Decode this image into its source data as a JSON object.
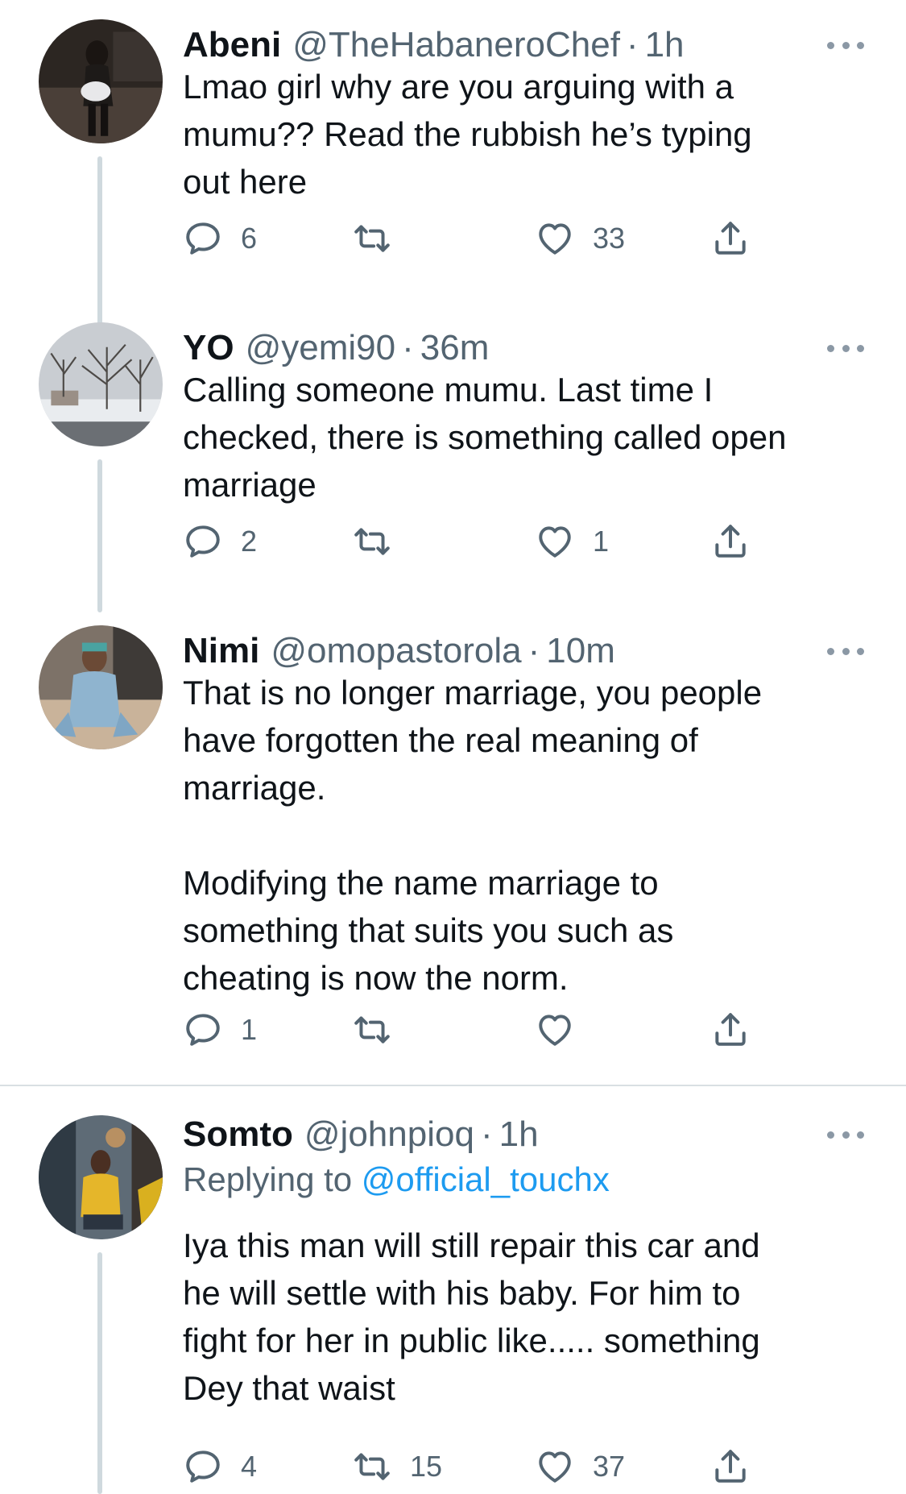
{
  "tweets": [
    {
      "name": "Abeni",
      "handle": "@TheHabaneroChef",
      "separator": "·",
      "time": "1h",
      "replying_label": "",
      "replying_handle": "",
      "text": "Lmao girl why are you arguing with a\nmumu?? Read the rubbish he’s typing\nout here",
      "replies": "6",
      "retweets": "",
      "likes": "33",
      "avatar_icon": "profile-photo-dark-interior"
    },
    {
      "name": "YO",
      "handle": "@yemi90",
      "separator": "·",
      "time": "36m",
      "replying_label": "",
      "replying_handle": "",
      "text": "Calling someone mumu. Last time I\nchecked, there is something called open\nmarriage",
      "replies": "2",
      "retweets": "",
      "likes": "1",
      "avatar_icon": "profile-photo-snowy-trees"
    },
    {
      "name": "Nimi",
      "handle": "@omopastorola",
      "separator": "·",
      "time": "10m",
      "replying_label": "",
      "replying_handle": "",
      "text": "That is no longer marriage, you people\nhave forgotten the real meaning of\nmarriage.\n\nModifying the name marriage to\nsomething that suits you such as\ncheating is now the norm.",
      "replies": "1",
      "retweets": "",
      "likes": "",
      "avatar_icon": "profile-photo-person-denim"
    },
    {
      "name": "Somto",
      "handle": "@johnpioq",
      "separator": "·",
      "time": "1h",
      "replying_label": "Replying to ",
      "replying_handle": "@official_touchx",
      "text": "Iya this man will still repair this car and\nhe will settle with his baby. For him to\nfight for her in public like..... something\nDey that waist",
      "replies": "4",
      "retweets": "15",
      "likes": "37",
      "avatar_icon": "profile-photo-person-yellow-shirt"
    }
  ],
  "colors": {
    "text": "#0f1419",
    "secondary": "#536471",
    "link": "#1d9bf0",
    "thread_line": "#cfd9de",
    "divider": "#d9dfe3"
  }
}
